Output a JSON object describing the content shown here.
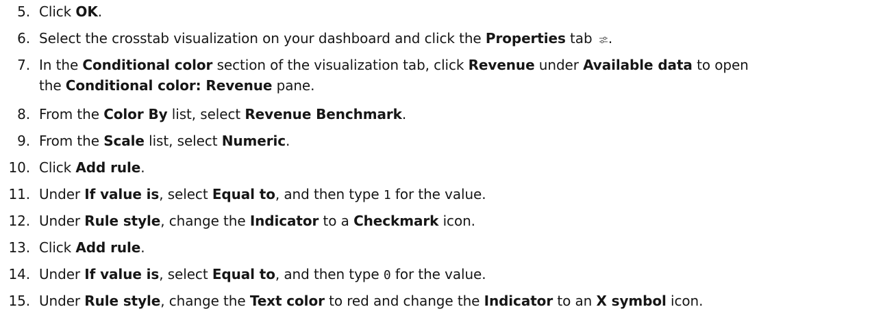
{
  "steps": [
    {
      "num": "5.",
      "parts": [
        {
          "t": "Click "
        },
        {
          "t": "OK",
          "b": true
        },
        {
          "t": "."
        }
      ]
    },
    {
      "num": "6.",
      "parts": [
        {
          "t": "Select the crosstab visualization on your dashboard and click the "
        },
        {
          "t": "Properties",
          "b": true
        },
        {
          "t": " tab "
        },
        {
          "icon": "properties-icon"
        },
        {
          "t": "."
        }
      ]
    },
    {
      "num": "7.",
      "parts": [
        {
          "t": "In the "
        },
        {
          "t": "Conditional color",
          "b": true
        },
        {
          "t": " section of the visualization tab, click "
        },
        {
          "t": "Revenue",
          "b": true
        },
        {
          "t": " under "
        },
        {
          "t": "Available data",
          "b": true
        },
        {
          "t": " to open"
        }
      ],
      "parts2": [
        {
          "t": "the "
        },
        {
          "t": "Conditional color: Revenue",
          "b": true
        },
        {
          "t": " pane."
        }
      ]
    },
    {
      "num": "8.",
      "parts": [
        {
          "t": "From the "
        },
        {
          "t": "Color By",
          "b": true
        },
        {
          "t": " list, select "
        },
        {
          "t": "Revenue Benchmark",
          "b": true
        },
        {
          "t": "."
        }
      ]
    },
    {
      "num": "9.",
      "parts": [
        {
          "t": "From the "
        },
        {
          "t": "Scale",
          "b": true
        },
        {
          "t": " list, select "
        },
        {
          "t": "Numeric",
          "b": true
        },
        {
          "t": "."
        }
      ]
    },
    {
      "num": "10.",
      "parts": [
        {
          "t": "Click "
        },
        {
          "t": "Add rule",
          "b": true
        },
        {
          "t": "."
        }
      ]
    },
    {
      "num": "11.",
      "parts": [
        {
          "t": "Under "
        },
        {
          "t": "If value is",
          "b": true
        },
        {
          "t": ", select "
        },
        {
          "t": "Equal to",
          "b": true
        },
        {
          "t": ", and then type "
        },
        {
          "t": "1",
          "m": true
        },
        {
          "t": " for the value."
        }
      ]
    },
    {
      "num": "12.",
      "parts": [
        {
          "t": "Under "
        },
        {
          "t": "Rule style",
          "b": true
        },
        {
          "t": ", change the "
        },
        {
          "t": "Indicator",
          "b": true
        },
        {
          "t": " to a "
        },
        {
          "t": "Checkmark",
          "b": true
        },
        {
          "t": " icon."
        }
      ]
    },
    {
      "num": "13.",
      "parts": [
        {
          "t": "Click "
        },
        {
          "t": "Add rule",
          "b": true
        },
        {
          "t": "."
        }
      ]
    },
    {
      "num": "14.",
      "parts": [
        {
          "t": "Under "
        },
        {
          "t": "If value is",
          "b": true
        },
        {
          "t": ", select "
        },
        {
          "t": "Equal to",
          "b": true
        },
        {
          "t": ", and then type "
        },
        {
          "t": "0",
          "m": true
        },
        {
          "t": " for the value."
        }
      ]
    },
    {
      "num": "15.",
      "parts": [
        {
          "t": "Under "
        },
        {
          "t": "Rule style",
          "b": true
        },
        {
          "t": ", change the "
        },
        {
          "t": "Text color",
          "b": true
        },
        {
          "t": " to red and change the "
        },
        {
          "t": "Indicator",
          "b": true
        },
        {
          "t": " to an "
        },
        {
          "t": "X symbol",
          "b": true
        },
        {
          "t": " icon."
        }
      ]
    }
  ]
}
